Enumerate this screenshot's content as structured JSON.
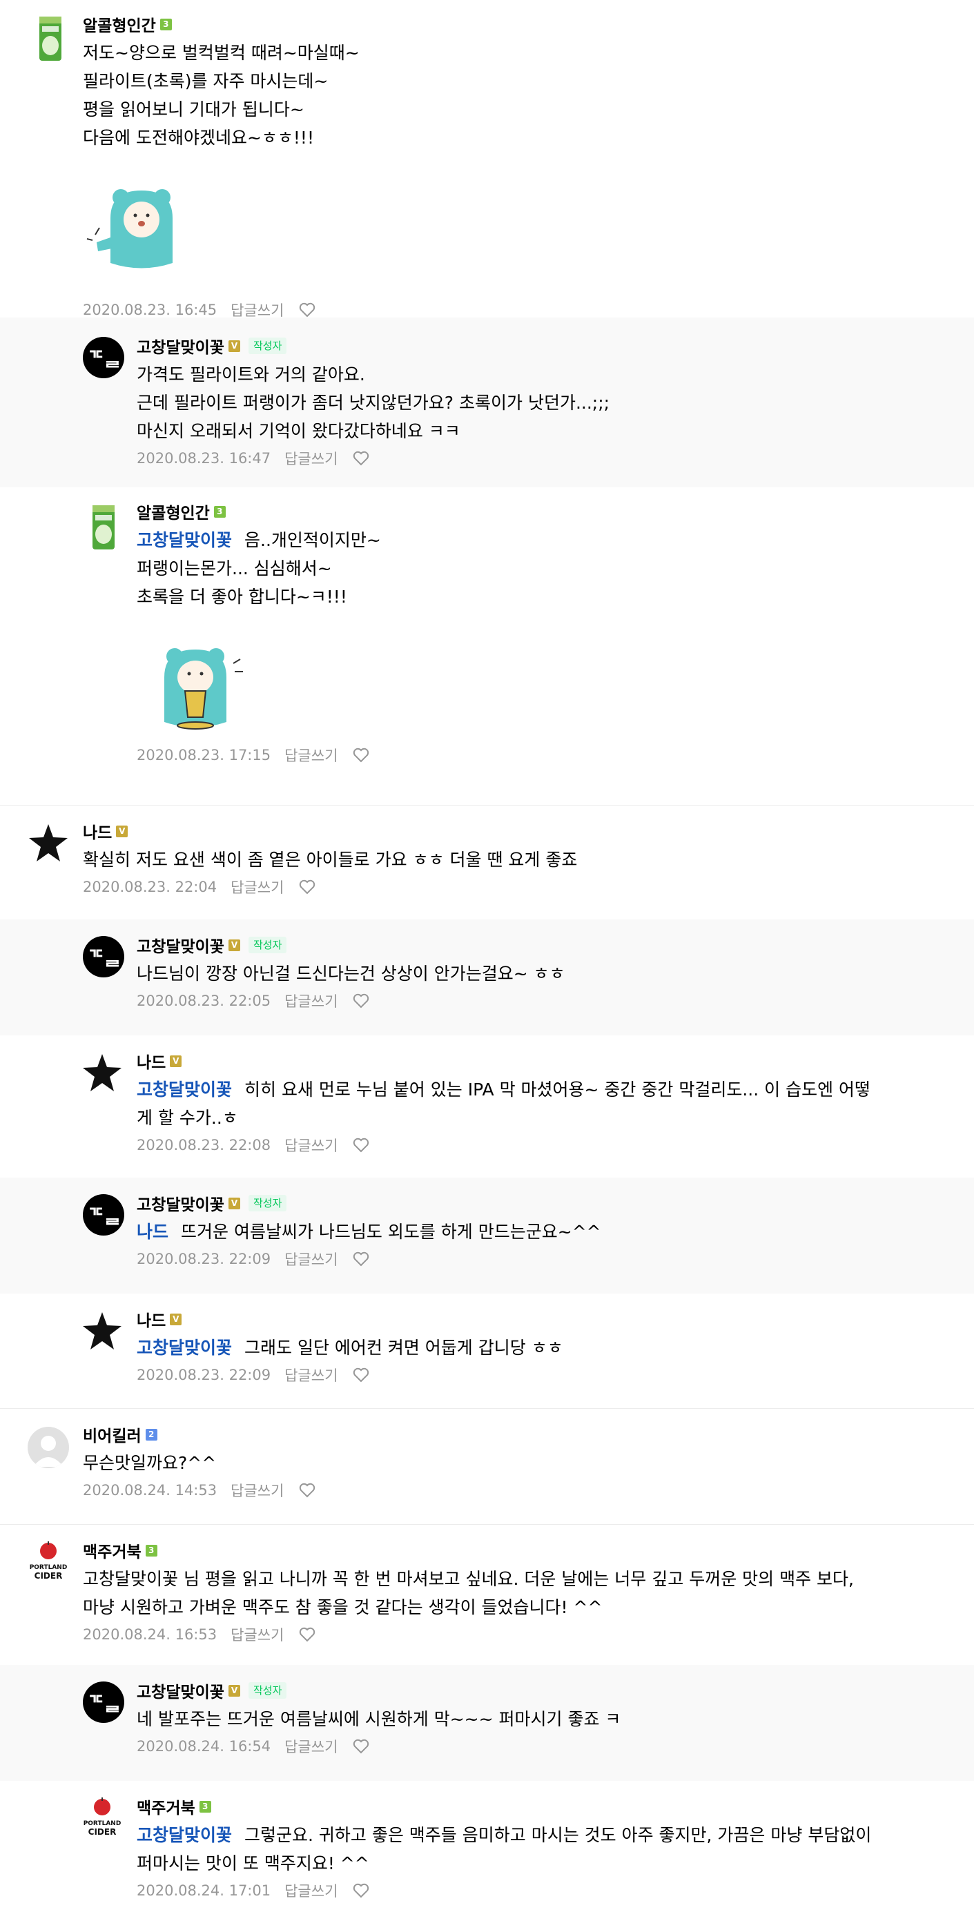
{
  "reply_label": "답글쓰기",
  "author_badge": "작성자",
  "comments": [
    {
      "nick": "알콜형인간",
      "level": "3",
      "lines": [
        "저도~양으로 벌컥벌컥 때려~마실때~",
        "필라이트(초록)를 자주 마시는데~",
        "평을 읽어보니 기대가 됩니다~",
        "다음에 도전해야겠네요~ㅎㅎ!!!"
      ],
      "time": "2020.08.23. 16:45"
    },
    {
      "nick": "고창달맞이꽃",
      "level": "V",
      "lines": [
        "가격도 필라이트와 거의 같아요.",
        "근데 필라이트 퍼랭이가 좀더 낫지않던가요? 초록이가 낫던가...;;;",
        "마신지 오래되서 기억이 왔다갔다하네요 ㅋㅋ"
      ],
      "time": "2020.08.23. 16:47"
    },
    {
      "nick": "알콜형인간",
      "level": "3",
      "mention": "고창달맞이꽃",
      "lines": [
        "음..개인적이지만~",
        "퍼랭이는몬가... 심심해서~",
        "초록을 더 좋아 합니다~ㅋ!!!"
      ],
      "time": "2020.08.23. 17:15"
    },
    {
      "nick": "나드",
      "level": "V",
      "lines": [
        "확실히 저도 요샌 색이 좀 옅은 아이들로 가요 ㅎㅎ 더울 땐 요게 좋죠"
      ],
      "time": "2020.08.23. 22:04"
    },
    {
      "nick": "고창달맞이꽃",
      "level": "V",
      "lines": [
        "나드님이 깡장 아닌걸 드신다는건 상상이 안가는걸요~ ㅎㅎ"
      ],
      "time": "2020.08.23. 22:05"
    },
    {
      "nick": "나드",
      "level": "V",
      "mention": "고창달맞이꽃",
      "lines": [
        "히히 요새 먼로 누님 붙어 있는 IPA 막 마셨어용~ 중간 중간 막걸리도... 이 습도엔 어떻",
        "게 할 수가..ㅎ"
      ],
      "time": "2020.08.23. 22:08"
    },
    {
      "nick": "고창달맞이꽃",
      "level": "V",
      "mention": "나드",
      "lines": [
        "뜨거운 여름날씨가 나드님도 외도를 하게 만드는군요~^^"
      ],
      "time": "2020.08.23. 22:09"
    },
    {
      "nick": "나드",
      "level": "V",
      "mention": "고창달맞이꽃",
      "lines": [
        "그래도 일단 에어컨 켜면 어둡게 갑니당 ㅎㅎ"
      ],
      "time": "2020.08.23. 22:09"
    },
    {
      "nick": "비어킬러",
      "level": "2",
      "lines": [
        "무슨맛일까요?^^"
      ],
      "time": "2020.08.24. 14:53"
    },
    {
      "nick": "맥주거북",
      "level": "3",
      "lines": [
        "고창달맞이꽃 님 평을 읽고 나니까 꼭 한 번 마셔보고 싶네요. 더운 날에는 너무 깊고 두꺼운 맛의 맥주 보다,",
        "마냥 시원하고 가벼운 맥주도 참 좋을 것 같다는 생각이 들었습니다! ^^"
      ],
      "time": "2020.08.24. 16:53"
    },
    {
      "nick": "고창달맞이꽃",
      "level": "V",
      "lines": [
        "네 발포주는 뜨거운 여름날씨에 시원하게 막~~~ 퍼마시기 좋죠 ㅋ"
      ],
      "time": "2020.08.24. 16:54"
    },
    {
      "nick": "맥주거북",
      "level": "3",
      "mention": "고창달맞이꽃",
      "lines": [
        "그렇군요. 귀하고 좋은 맥주들 음미하고 마시는 것도 아주 좋지만, 가끔은 마냥 부담없이",
        "퍼마시는 맛이 또 맥주지요! ^^"
      ],
      "time": "2020.08.24. 17:01"
    }
  ]
}
